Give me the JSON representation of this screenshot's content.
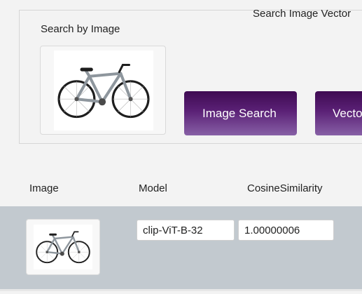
{
  "search": {
    "panel_title": "Search Image Vector",
    "label": "Search by Image",
    "image_search_button": "Image Search",
    "vector_search_button": "Vector Search"
  },
  "results": {
    "columns": [
      "Image",
      "Model",
      "CosineSimilarity"
    ],
    "rows": [
      {
        "model": "clip-ViT-B-32",
        "cosine_similarity": "1.00000006"
      }
    ]
  },
  "colors": {
    "button_gradient_top": "#3e0a52",
    "button_gradient_bottom": "#8760a6",
    "row_highlight": "#c2c9cf"
  }
}
